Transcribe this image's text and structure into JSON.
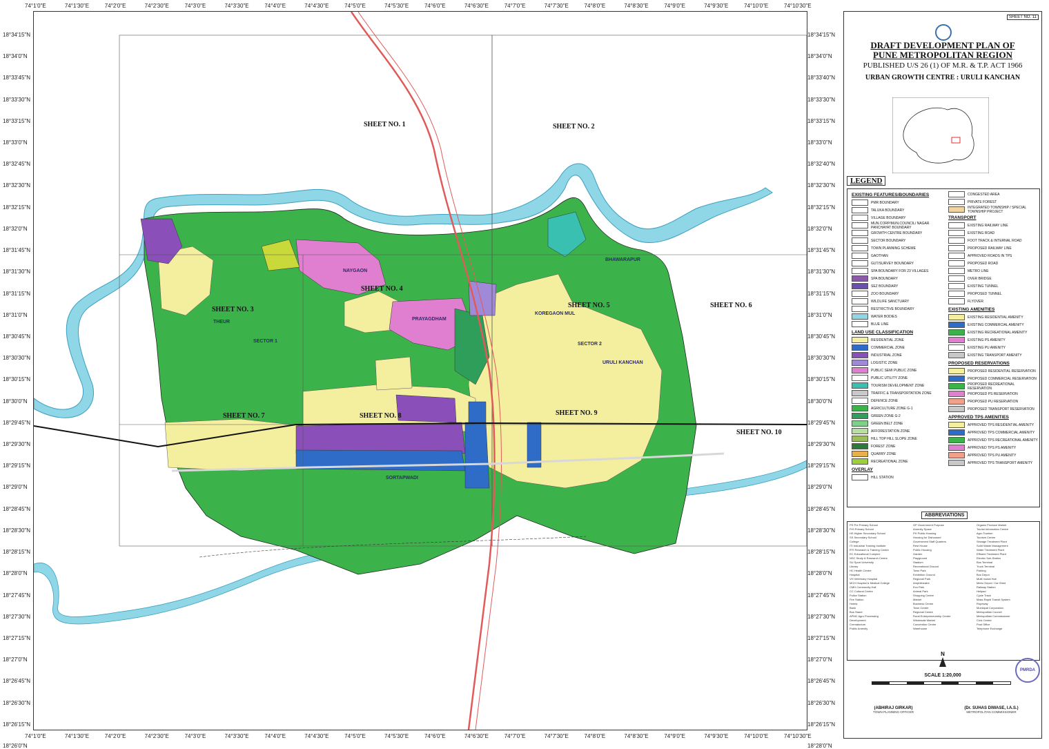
{
  "coords": {
    "top": [
      "74°1'0\"E",
      "74°1'30\"E",
      "74°2'0\"E",
      "74°2'30\"E",
      "74°3'0\"E",
      "74°3'30\"E",
      "74°4'0\"E",
      "74°4'30\"E",
      "74°5'0\"E",
      "74°5'30\"E",
      "74°6'0\"E",
      "74°6'30\"E",
      "74°7'0\"E",
      "74°7'30\"E",
      "74°8'0\"E",
      "74°8'30\"E",
      "74°9'0\"E",
      "74°9'30\"E",
      "74°10'0\"E",
      "74°10'30\"E"
    ],
    "bottom": [
      "74°1'0\"E",
      "74°1'30\"E",
      "74°2'0\"E",
      "74°2'30\"E",
      "74°3'0\"E",
      "74°3'30\"E",
      "74°4'0\"E",
      "74°4'30\"E",
      "74°5'0\"E",
      "74°5'30\"E",
      "74°6'0\"E",
      "74°6'30\"E",
      "74°7'0\"E",
      "74°7'30\"E",
      "74°8'0\"E",
      "74°8'30\"E",
      "74°9'0\"E",
      "74°9'30\"E",
      "74°10'0\"E",
      "74°10'30\"E"
    ],
    "left": [
      "18°34'15\"N",
      "18°34'0\"N",
      "18°33'45\"N",
      "18°33'30\"N",
      "18°33'15\"N",
      "18°33'0\"N",
      "18°32'45\"N",
      "18°32'30\"N",
      "18°32'15\"N",
      "18°32'0\"N",
      "18°31'45\"N",
      "18°31'30\"N",
      "18°31'15\"N",
      "18°31'0\"N",
      "18°30'45\"N",
      "18°30'30\"N",
      "18°30'15\"N",
      "18°30'0\"N",
      "18°29'45\"N",
      "18°29'30\"N",
      "18°29'15\"N",
      "18°29'0\"N",
      "18°28'45\"N",
      "18°28'30\"N",
      "18°28'15\"N",
      "18°28'0\"N",
      "18°27'45\"N",
      "18°27'30\"N",
      "18°27'15\"N",
      "18°27'0\"N",
      "18°26'45\"N",
      "18°26'30\"N",
      "18°26'15\"N",
      "18°26'0\"N"
    ],
    "right": [
      "18°34'15\"N",
      "18°34'0\"N",
      "18°33'40\"N",
      "18°33'30\"N",
      "18°33'15\"N",
      "18°33'0\"N",
      "18°32'40\"N",
      "18°32'30\"N",
      "18°32'15\"N",
      "18°32'0\"N",
      "18°31'45\"N",
      "18°31'30\"N",
      "18°31'15\"N",
      "18°31'0\"N",
      "18°30'45\"N",
      "18°30'30\"N",
      "18°30'15\"N",
      "18°30'0\"N",
      "18°29'45\"N",
      "18°29'30\"N",
      "18°29'15\"N",
      "18°29'0\"N",
      "18°28'45\"N",
      "18°28'30\"N",
      "18°28'15\"N",
      "18°28'0\"N",
      "18°27'45\"N",
      "18°27'30\"N",
      "18°27'15\"N",
      "18°27'0\"N",
      "18°26'45\"N",
      "18°26'30\"N",
      "18°26'15\"N",
      "18°28'0\"N"
    ]
  },
  "sheets": [
    "SHEET NO. 1",
    "SHEET NO. 2",
    "SHEET NO. 3",
    "SHEET NO. 4",
    "SHEET NO. 5",
    "SHEET NO. 6",
    "SHEET NO. 7",
    "SHEET NO. 8",
    "SHEET NO. 9",
    "SHEET NO. 10"
  ],
  "places": {
    "naygaon": "NAYGAON",
    "prayagdham": "PRAYAGDHAM",
    "koregaon": "KOREGAON MUL",
    "bhawarapur": "BHAWARAPUR",
    "shindwane": "SHINDWANE",
    "uruli": "URULI KANCHAN",
    "sector1": "SECTOR 1",
    "sector2": "SECTOR 2",
    "theur": "THEUR",
    "sortapwadi": "SORTAPWADI"
  },
  "panel": {
    "sheet_no": "SHEET NO. 11",
    "title1": "DRAFT DEVELOPMENT PLAN OF",
    "title2": "PUNE METROPOLITAN REGION",
    "title3": "PUBLISHED U/S 26 (1) OF M.R. & T.P. ACT 1966",
    "title4": "URBAN GROWTH CENTRE : URULI KANCHAN",
    "legend": "LEGEND",
    "abbreviations": "ABBREVIATIONS",
    "scale": "SCALE 1:20,000",
    "north": "N",
    "sig1_name": "(ABHIRAJ GIRKAR)",
    "sig1_title": "TOWN PLANNING OFFICER",
    "sig2_name": "(Dr. SUHAS DIWASE, I.A.S.)",
    "sig2_title": "METROPOLITAN COMMISSIONER",
    "stamp": "PMRDA"
  },
  "legend_left": [
    {
      "section": "EXISTING FEATURES/BOUNDARIES"
    },
    {
      "label": "PMR BOUNDARY",
      "color": "#ffffff"
    },
    {
      "label": "TALUKA BOUNDARY",
      "color": "#ffffff"
    },
    {
      "label": "VILLAGE BOUNDARY",
      "color": "#ffffff"
    },
    {
      "label": "MUN.CORP/MUN.COUNCIL/ NAGAR PANCHAYAT BOUNDARY",
      "color": "#ffffff"
    },
    {
      "label": "GROWTH CENTRE BOUNDARY",
      "color": "#ffffff"
    },
    {
      "label": "SECTOR BOUNDARY",
      "color": "#ffffff"
    },
    {
      "label": "TOWN PLANNING SCHEME",
      "color": "#ffffff"
    },
    {
      "label": "GAOTHAN",
      "color": "#ffffff"
    },
    {
      "label": "GUT/SURVEY BOUNDARY",
      "color": "#ffffff"
    },
    {
      "label": "SPA BOUNDARY FOR 23 VILLAGES",
      "color": "#ffffff"
    },
    {
      "label": "SPA BOUNDARY",
      "color": "#8a5aa8"
    },
    {
      "label": "SEZ BOUNDARY",
      "color": "#6a4fb0"
    },
    {
      "label": "ZOO BOUNDARY",
      "color": "#ffffff"
    },
    {
      "label": "WILDLIFE SANCTUARY",
      "color": "#ffffff"
    },
    {
      "label": "RESTRICTIVE BOUNDARY",
      "color": "#ffffff"
    },
    {
      "label": "WATER BODIES",
      "color": "#8fd6e6"
    },
    {
      "label": "BLUE LINE",
      "color": "#ffffff"
    },
    {
      "section": "LAND USE CLASSIFICATION"
    },
    {
      "label": "RESIDENTIAL ZONE",
      "color": "#f4ee9f"
    },
    {
      "label": "COMMERCIAL ZONE",
      "color": "#2e6cc8"
    },
    {
      "label": "INDUSTRIAL ZONE",
      "color": "#8a4fb8"
    },
    {
      "label": "LOGISTIC ZONE",
      "color": "#a08ad8"
    },
    {
      "label": "PUBLIC SEMI PUBLIC ZONE",
      "color": "#e07fd0"
    },
    {
      "label": "PUBLIC UTILITY ZONE",
      "color": "#ffffff"
    },
    {
      "label": "TOURISM DEVELOPMENT ZONE",
      "color": "#39c0b0"
    },
    {
      "label": "TRAFFIC & TRANSPORTATION ZONE",
      "color": "#c8c8c8"
    },
    {
      "label": "DEFENCE ZONE",
      "color": "#ffffff"
    },
    {
      "label": "AGRICULTURE ZONE G-1",
      "color": "#3cb34a"
    },
    {
      "label": "GREEN ZONE G-2",
      "color": "#2e9e5a"
    },
    {
      "label": "GREEN BELT ZONE",
      "color": "#7fd08a"
    },
    {
      "label": "AFFORESTATION ZONE",
      "color": "#b6dfa0"
    },
    {
      "label": "HILL TOP HILL SLOPE ZONE",
      "color": "#9bbd5a"
    },
    {
      "label": "FOREST ZONE",
      "color": "#2b7a3a"
    },
    {
      "label": "QUARRY ZONE",
      "color": "#e8b04a"
    },
    {
      "label": "RECREATIONAL ZONE",
      "color": "#9ccf3a"
    },
    {
      "section": "OVERLAY"
    },
    {
      "label": "HILL STATION",
      "color": "#ffffff"
    }
  ],
  "legend_right": [
    {
      "label": "CONGESTED AREA",
      "color": "#ffffff"
    },
    {
      "label": "PRIVATE FOREST",
      "color": "#ffffff"
    },
    {
      "label": "INTEGRATED TOWNSHIP / SPECIAL TOWNSHIP PROJECT",
      "color": "#f3d3a0"
    },
    {
      "section": "TRANSPORT"
    },
    {
      "label": "EXISTING RAILWAY LINE",
      "color": "#ffffff"
    },
    {
      "label": "EXISTING ROAD",
      "color": "#ffffff"
    },
    {
      "label": "FOOT TRACK & INTERNAL ROAD",
      "color": "#ffffff"
    },
    {
      "label": "PROPOSED RAILWAY LINE",
      "color": "#ffffff"
    },
    {
      "label": "APPROVED ROADS IN TPS",
      "color": "#ffffff"
    },
    {
      "label": "PROPOSED ROAD",
      "color": "#ffffff"
    },
    {
      "label": "METRO LINE",
      "color": "#ffffff"
    },
    {
      "label": "OVER BRIDGE",
      "color": "#ffffff"
    },
    {
      "label": "EXISTING TUNNEL",
      "color": "#ffffff"
    },
    {
      "label": "PROPOSED TUNNEL",
      "color": "#ffffff"
    },
    {
      "label": "FLYOVER",
      "color": "#ffffff"
    },
    {
      "section": "EXISTING AMENITIES"
    },
    {
      "label": "EXISTING RESIDENTIAL AMENITY",
      "color": "#f4ee9f"
    },
    {
      "label": "EXISTING COMMERCIAL AMENITY",
      "color": "#2e6cc8"
    },
    {
      "label": "EXISTING RECREATIONAL AMENITY",
      "color": "#3cb34a"
    },
    {
      "label": "EXISTING PS AMENITY",
      "color": "#e07fd0"
    },
    {
      "label": "EXISTING PU AMENITY",
      "color": "#ffffff"
    },
    {
      "label": "EXISTING TRANSPORT AMENITY",
      "color": "#c8c8c8"
    },
    {
      "section": "PROPOSED RESERVATIONS"
    },
    {
      "label": "PROPOSED RESIDENTIAL RESERVATION",
      "color": "#f4ee9f"
    },
    {
      "label": "PROPOSED COMMERCIAL RESERVATION",
      "color": "#2e6cc8"
    },
    {
      "label": "PROPOSED RECREATIONAL RESERVATION",
      "color": "#3cb34a"
    },
    {
      "label": "PROPOSED PS RESERVATION",
      "color": "#e07fd0"
    },
    {
      "label": "PROPOSED PU RESERVATION",
      "color": "#f1a08a"
    },
    {
      "label": "PROPOSED TRANSPORT RESERVATION",
      "color": "#c8c8c8"
    },
    {
      "section": "APPROVED TPS AMENITIES"
    },
    {
      "label": "APPROVED TPS RESIDENTIAL AMENITY",
      "color": "#f4ee9f"
    },
    {
      "label": "APPROVED TPS COMMERCIAL AMENITY",
      "color": "#2e6cc8"
    },
    {
      "label": "APPROVED TPS RECREATIONAL AMENITY",
      "color": "#3cb34a"
    },
    {
      "label": "APPROVED TPS PS AMENITY",
      "color": "#e07fd0"
    },
    {
      "label": "APPROVED TPS PU AMENITY",
      "color": "#f1a08a"
    },
    {
      "label": "APPROVED TPS TRANSPORT AMENITY",
      "color": "#c8c8c8"
    }
  ],
  "abbr_cols": [
    [
      "PS Pre Primary School",
      "PrS Primary School",
      "HS Higher Secondary School",
      "SS Secondary School",
      "College",
      "ITI Industrial Training Institute",
      "RTI Research & Training Centre",
      "EC Educational Complex",
      "NSC Study & Research Centre",
      "SU Sport University",
      "Library",
      "HC Health Centre",
      "Hospital",
      "VH Veterinary Hospital",
      "MCH Hospital & Medical College",
      "CMH Community Hall",
      "CC Cultural Centre",
      "Police Station",
      "Fire Station",
      "Hotels",
      "Bank",
      "Bus Stand",
      "APMC Agro Processing",
      "Development",
      "Crematorium",
      "Public Amenity"
    ],
    [
      "GP Government Purpose",
      "Amenity Space",
      "PH Public Housing",
      "Housing for Dishoused",
      "Government Staff Quarters",
      "Rest House",
      "Public Housing",
      "Garden",
      "Playground",
      "Stadium",
      "Recreational Ground",
      "Town Park",
      "Exhibition Ground",
      "Regional Park",
      "Amphitheatre",
      "Eco Park",
      "Animal Park",
      "Shopping Centre",
      "Market",
      "Business Centre",
      "Town Centre",
      "Regional Centre",
      "Rural Entrepreneurship Centre",
      "Wholesale Market",
      "Convention Centre",
      "Warehouse"
    ],
    [
      "Organic Produce Market",
      "Tourist Information Centre",
      "Agro Tourism",
      "Tourism Centre",
      "Sewage Treatment Plant",
      "Solid Waste Management",
      "Water Treatment Plant",
      "Effluent Treatment Plant",
      "Electric Sub-Station",
      "Bus Terminal",
      "Truck Terminal",
      "Parking",
      "Bus Depot",
      "Multi modal Hub",
      "Metro Depot / Car Shed",
      "Railway Station",
      "Helipad",
      "Cycle Track",
      "Mass Rapid Transit System",
      "Ropeway",
      "Municipal Corporation",
      "Metropolitan Council",
      "Metropolitan Commissioner",
      "Civic Centre",
      "Post Office",
      "Telephone Exchange"
    ]
  ]
}
